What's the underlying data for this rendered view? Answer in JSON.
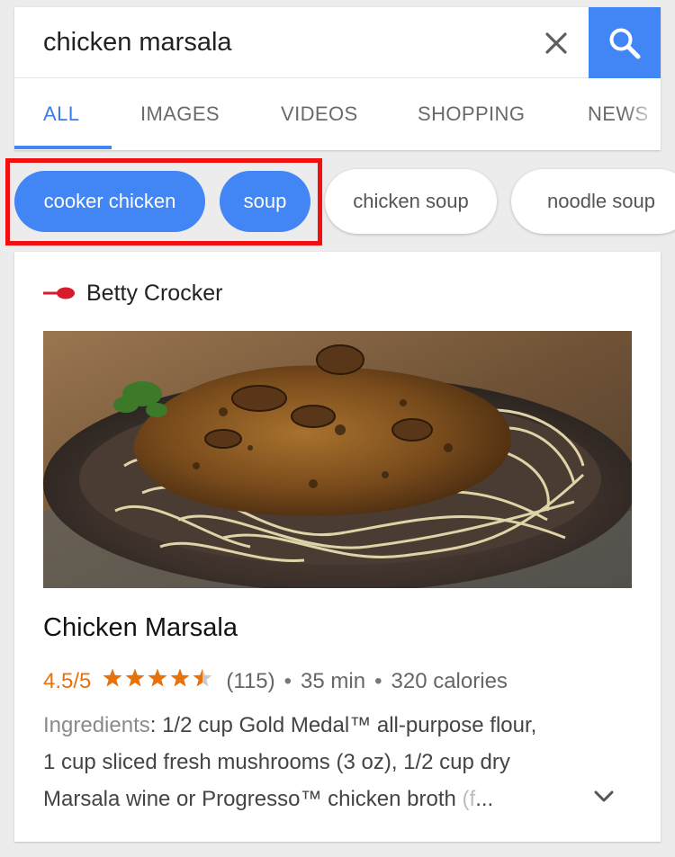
{
  "search": {
    "query": "chicken marsala"
  },
  "tabs": [
    {
      "label": "ALL",
      "active": true
    },
    {
      "label": "IMAGES",
      "active": false
    },
    {
      "label": "VIDEOS",
      "active": false
    },
    {
      "label": "SHOPPING",
      "active": false
    },
    {
      "label": "NEWS",
      "active": false
    }
  ],
  "chips": [
    {
      "label": "cooker chicken",
      "selected": true
    },
    {
      "label": "soup",
      "selected": true
    },
    {
      "label": "chicken soup",
      "selected": false
    },
    {
      "label": "noodle soup",
      "selected": false
    }
  ],
  "result": {
    "source": "Betty Crocker",
    "title": "Chicken Marsala",
    "rating": "4.5/5",
    "stars": 4.5,
    "reviews": "(115)",
    "time": "35 min",
    "calories": "320 calories",
    "separator": "•",
    "ingredients_label": "Ingredients",
    "ingredients_line1": ": 1/2 cup Gold Medal™ all-purpose flour,",
    "ingredients_line2": "1 cup sliced fresh mushrooms (3 oz), 1/2 cup dry",
    "ingredients_line3": "Marsala wine or Progresso™ chicken broth",
    "ingredients_faded": " (f",
    "ellipsis": "..."
  },
  "colors": {
    "accent": "#4285f4",
    "highlight": "#f20f0f",
    "rating": "#e8710a"
  },
  "icons": {
    "clear": "close-icon",
    "search": "search-icon",
    "source": "betty-crocker-spoon-icon",
    "expand": "chevron-down-icon"
  }
}
